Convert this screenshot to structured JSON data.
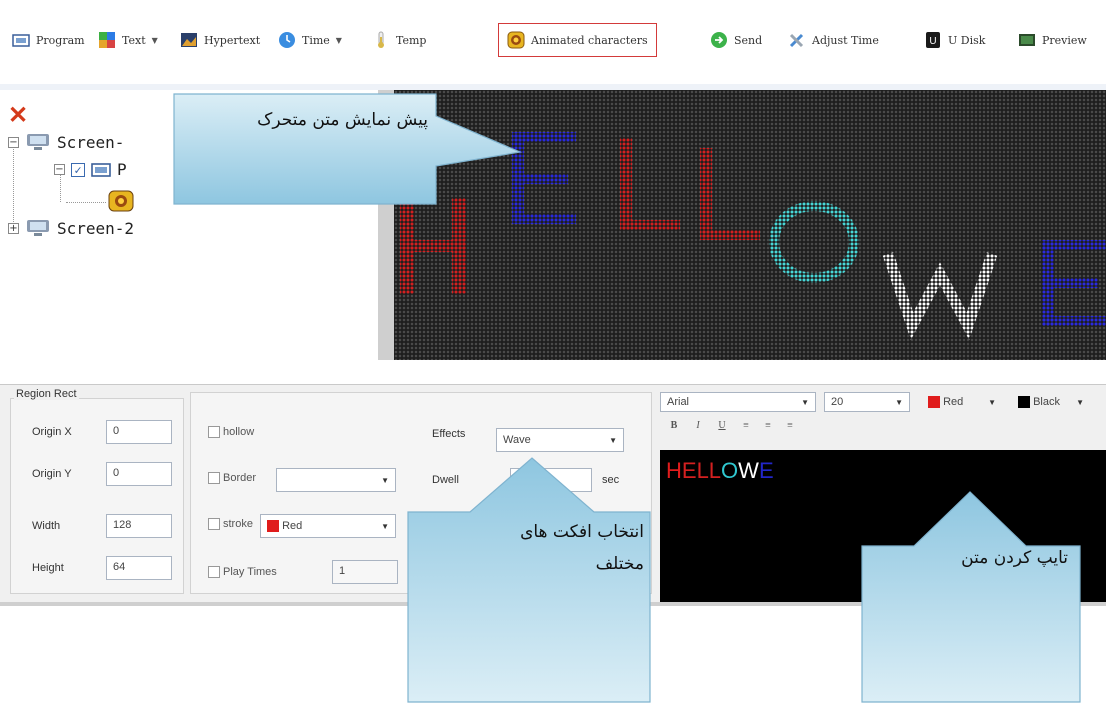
{
  "toolbar": {
    "items": [
      {
        "label": "Program",
        "icon": "program-icon",
        "caret": false
      },
      {
        "label": "Text",
        "icon": "text-icon",
        "caret": true
      },
      {
        "label": "Hypertext",
        "icon": "hypertext-icon",
        "caret": false
      },
      {
        "label": "Time",
        "icon": "time-icon",
        "caret": true
      },
      {
        "label": "Temp",
        "icon": "thermometer-icon",
        "caret": false
      },
      {
        "label": "Animated characters",
        "icon": "animated-characters-icon",
        "caret": false
      },
      {
        "label": "Send",
        "icon": "send-icon",
        "caret": false
      },
      {
        "label": "Adjust Time",
        "icon": "adjust-time-icon",
        "caret": false
      },
      {
        "label": "U Disk",
        "icon": "u-disk-icon",
        "caret": false
      },
      {
        "label": "Preview",
        "icon": "preview-icon",
        "caret": false
      }
    ],
    "highlighted_item": "Animated characters",
    "highlight_color": "#d33a3a"
  },
  "tree": {
    "screen1_label": "Screen-",
    "program_label": "P",
    "screen2_label": "Screen-2"
  },
  "led_preview": {
    "text": "HELLOWE",
    "letter_colors": [
      "#c01818",
      "#1a20c8",
      "#d01818",
      "#d01818",
      "#40d0d0",
      "#ffffff",
      "#1a20c8"
    ]
  },
  "region": {
    "title": "Region Rect",
    "origin_x_label": "Origin X",
    "origin_x": "0",
    "origin_y_label": "Origin Y",
    "origin_y": "0",
    "width_label": "Width",
    "width": "128",
    "height_label": "Height",
    "height": "64"
  },
  "options": {
    "hollow_label": "hollow",
    "border_label": "Border",
    "stroke_label": "stroke",
    "stroke_color_label": "Red",
    "play_times_label": "Play Times",
    "play_times_value": "1",
    "effects_label": "Effects",
    "effects_value": "Wave",
    "dwell_label": "Dwell",
    "dwell_unit": "sec"
  },
  "font_bar": {
    "font_name": "Arial",
    "font_size": "20",
    "fg_color_label": "Red",
    "bg_color_label": "Black",
    "bold": "B",
    "italic": "I",
    "underline": "U"
  },
  "editor": {
    "segments": [
      {
        "text": "H",
        "color": "#e01c1c"
      },
      {
        "text": "ELL",
        "color": "#d42020"
      },
      {
        "text": "O",
        "color": "#30c8d0"
      },
      {
        "text": "W",
        "color": "#ffffff"
      },
      {
        "text": "E",
        "color": "#2226c8"
      }
    ]
  },
  "callouts": {
    "preview": "پیش نمایش متن متحرک",
    "effects_line1": "انتخاب افکت های",
    "effects_line2": "مختلف",
    "typing": "تایپ کردن متن"
  }
}
